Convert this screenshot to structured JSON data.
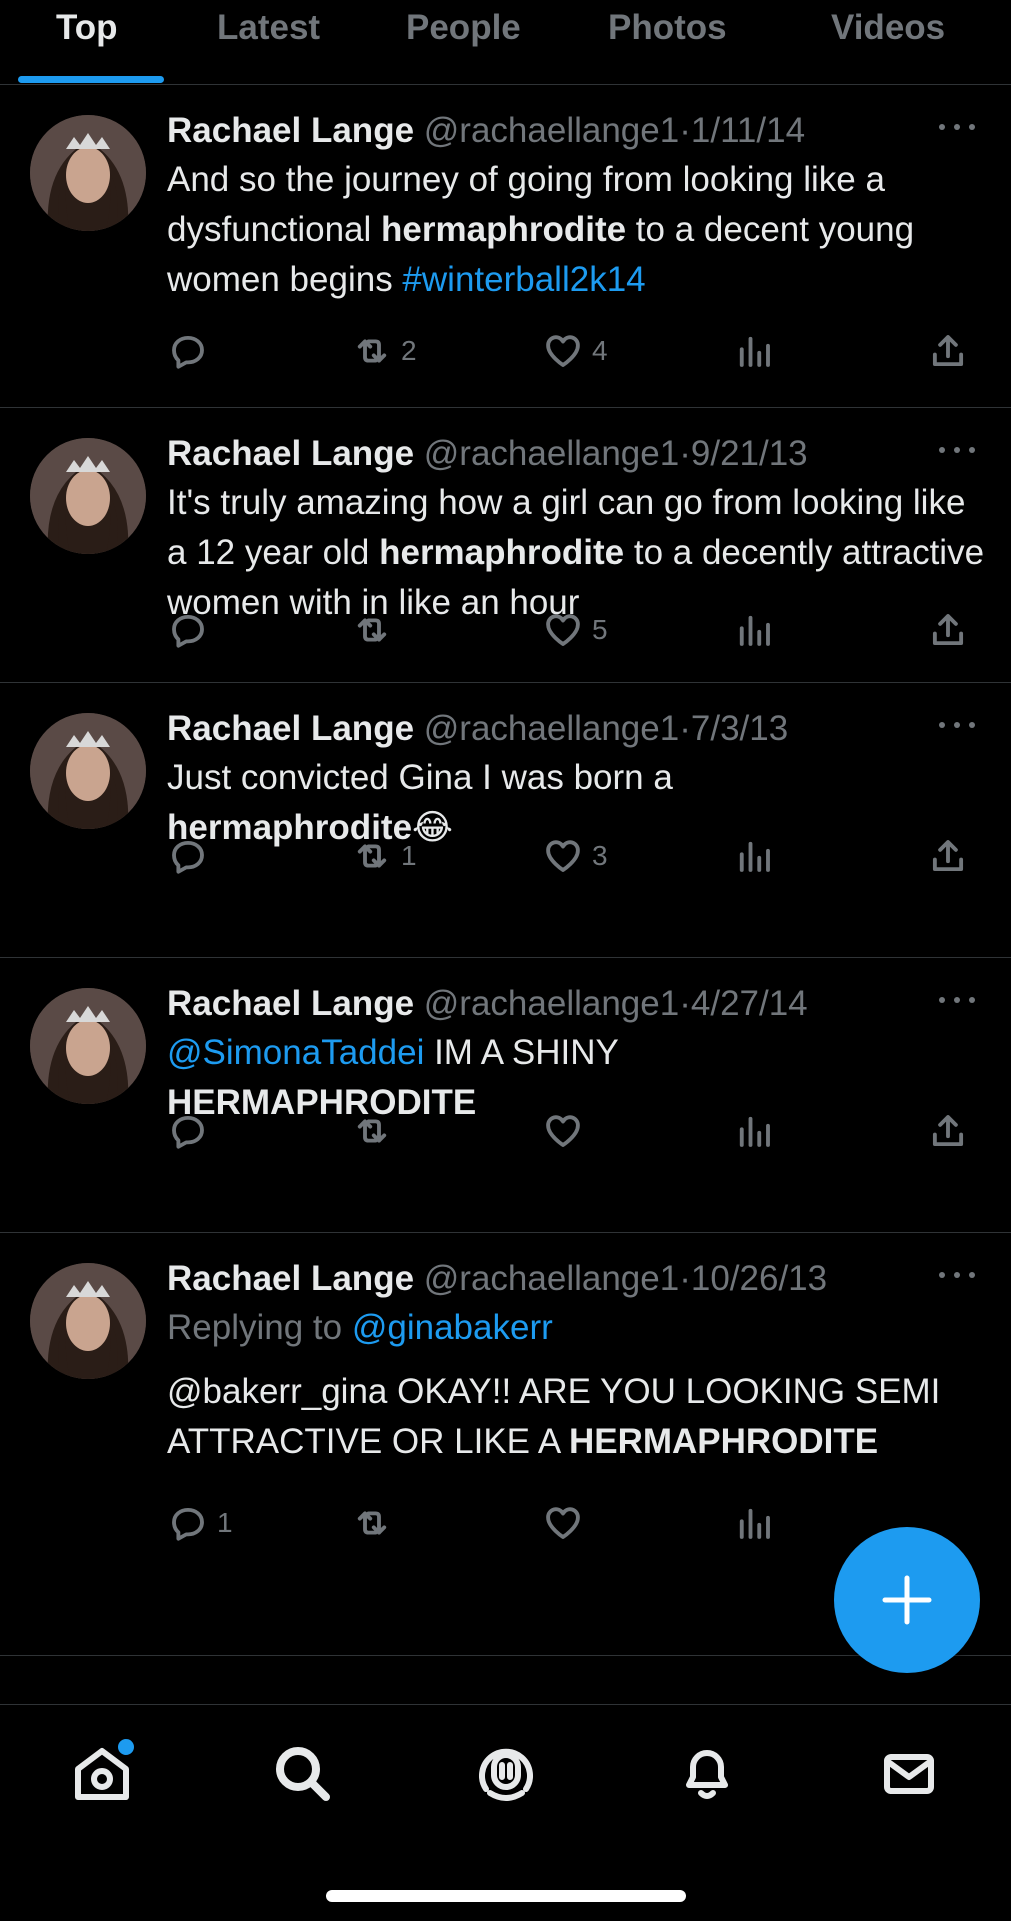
{
  "tabs": [
    "Top",
    "Latest",
    "People",
    "Photos",
    "Videos"
  ],
  "active_tab": "Top",
  "colors": {
    "accent": "#1d9bf0",
    "background": "#000000",
    "muted": "#71767b",
    "text": "#e7e9ea"
  },
  "tweets": [
    {
      "name": "Rachael Lange",
      "handle": "@rachaellange1",
      "dot": "·",
      "date": "1/11/14",
      "text": [
        {
          "t": "And so the journey of going from looking like a dysfunctional "
        },
        {
          "t": "hermaphrodite"
        },
        {
          "t": " to a decent young women begins "
        },
        {
          "t": "#winterball2k14"
        }
      ],
      "replies": "",
      "retweets": "2",
      "likes": "4"
    },
    {
      "name": "Rachael Lange",
      "handle": "@rachaellange1",
      "dot": "·",
      "date": "9/21/13",
      "text": [
        {
          "t": "It's truly amazing how a girl can go from looking like a 12 year old "
        },
        {
          "t": "hermaphrodite"
        },
        {
          "t": " to a decently attractive women with in like an hour"
        }
      ],
      "replies": "",
      "retweets": "",
      "likes": "5"
    },
    {
      "name": "Rachael Lange",
      "handle": "@rachaellange1",
      "dot": "·",
      "date": "7/3/13",
      "text": [
        {
          "t": "Just convicted Gina I was born a "
        },
        {
          "t": "hermaphrodite"
        },
        {
          "t": "😂"
        }
      ],
      "replies": "",
      "retweets": "1",
      "likes": "3"
    },
    {
      "name": "Rachael Lange",
      "handle": "@rachaellange1",
      "dot": "·",
      "date": "4/27/14",
      "text": [
        {
          "t": "@SimonaTaddei"
        },
        {
          "t": " IM A SHINY "
        },
        {
          "t": "HERMAPHRODITE"
        }
      ],
      "replies": "",
      "retweets": "",
      "likes": ""
    },
    {
      "name": "Rachael Lange",
      "handle": "@rachaellange1",
      "dot": "·",
      "date": "10/26/13",
      "replying_prefix": "Replying to",
      "replying_to": "@ginabakerr",
      "text": [
        {
          "t": "@bakerr_gina OKAY!! ARE YOU LOOKING SEMI ATTRACTIVE OR LIKE A "
        },
        {
          "t": "HERMAPHRODITE"
        }
      ],
      "replies": "1",
      "retweets": "",
      "likes": ""
    }
  ],
  "icons": {
    "reply": "reply-icon",
    "retweet": "retweet-icon",
    "like": "heart-icon",
    "views": "views-icon",
    "share": "share-icon",
    "more": "more-icon",
    "compose": "plus-icon",
    "home": "home-icon",
    "search": "search-icon",
    "spaces": "spaces-icon",
    "notifications": "bell-icon",
    "messages": "mail-icon"
  }
}
